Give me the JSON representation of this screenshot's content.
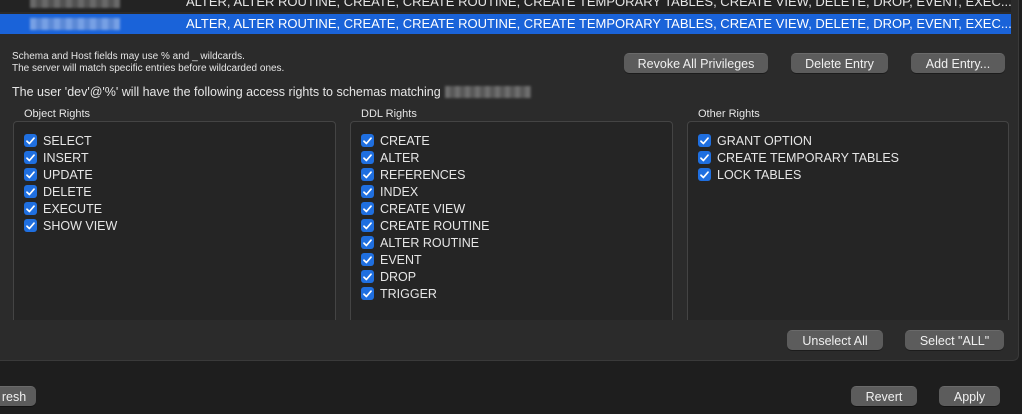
{
  "schema_rows": [
    {
      "privileges": "ALTER, ALTER ROUTINE, CREATE, CREATE ROUTINE, CREATE TEMPORARY TABLES, CREATE VIEW, DELETE, DROP, EVENT, EXEC..."
    },
    {
      "privileges": "ALTER, ALTER ROUTINE, CREATE, CREATE ROUTINE, CREATE TEMPORARY TABLES, CREATE VIEW, DELETE, DROP, EVENT, EXEC..."
    }
  ],
  "hint_line1": "Schema and Host fields may use % and _ wildcards.",
  "hint_line2": "The server will match specific entries before wildcarded ones.",
  "buttons": {
    "revoke": "Revoke All Privileges",
    "delete": "Delete Entry",
    "add": "Add Entry...",
    "unselect_all": "Unselect All",
    "select_all": "Select \"ALL\"",
    "refresh": "resh",
    "revert": "Revert",
    "apply": "Apply"
  },
  "access_sentence": "The user 'dev'@'%' will have the following access rights to schemas matching",
  "groups": {
    "object": {
      "title": "Object Rights",
      "items": [
        {
          "label": "SELECT",
          "checked": true
        },
        {
          "label": "INSERT",
          "checked": true
        },
        {
          "label": "UPDATE",
          "checked": true
        },
        {
          "label": "DELETE",
          "checked": true
        },
        {
          "label": "EXECUTE",
          "checked": true
        },
        {
          "label": "SHOW VIEW",
          "checked": true
        }
      ]
    },
    "ddl": {
      "title": "DDL Rights",
      "items": [
        {
          "label": "CREATE",
          "checked": true
        },
        {
          "label": "ALTER",
          "checked": true
        },
        {
          "label": "REFERENCES",
          "checked": true
        },
        {
          "label": "INDEX",
          "checked": true
        },
        {
          "label": "CREATE VIEW",
          "checked": true
        },
        {
          "label": "CREATE ROUTINE",
          "checked": true
        },
        {
          "label": "ALTER ROUTINE",
          "checked": true
        },
        {
          "label": "EVENT",
          "checked": true
        },
        {
          "label": "DROP",
          "checked": true
        },
        {
          "label": "TRIGGER",
          "checked": true
        }
      ]
    },
    "other": {
      "title": "Other Rights",
      "items": [
        {
          "label": "GRANT OPTION",
          "checked": true
        },
        {
          "label": "CREATE TEMPORARY TABLES",
          "checked": true
        },
        {
          "label": "LOCK TABLES",
          "checked": true
        }
      ]
    }
  },
  "colors": {
    "selection": "#1a63d9",
    "checkbox": "#1f6fe0"
  }
}
